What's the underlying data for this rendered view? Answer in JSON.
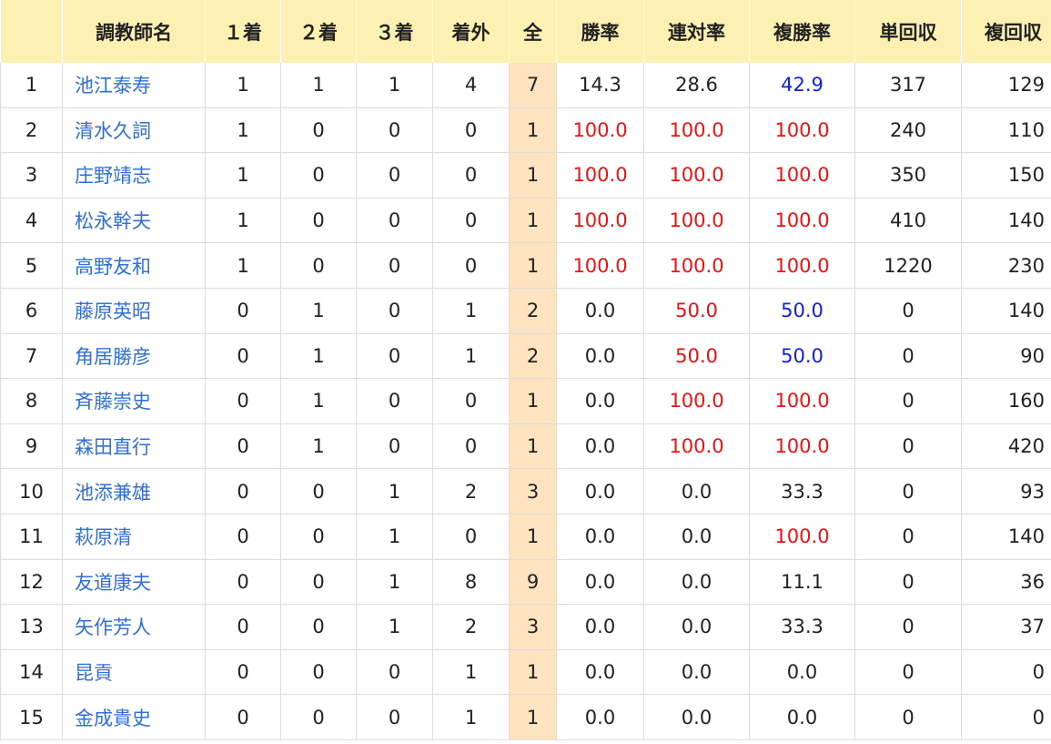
{
  "header": {
    "rank": "",
    "trainer": "調教師名",
    "first": "１着",
    "second": "２着",
    "third": "３着",
    "out": "着外",
    "total": "全",
    "win_rate": "勝率",
    "quinella_rate": "連対率",
    "place_rate": "複勝率",
    "win_return": "単回収",
    "place_return": "複回収"
  },
  "rows": [
    {
      "rank": "1",
      "name": "池江泰寿",
      "c1": "1",
      "c2": "1",
      "c3": "1",
      "out": "4",
      "total": "7",
      "win": "14.3",
      "quin": "28.6",
      "place": "42.9",
      "wret": "317",
      "pret": "129"
    },
    {
      "rank": "2",
      "name": "清水久詞",
      "c1": "1",
      "c2": "0",
      "c3": "0",
      "out": "0",
      "total": "1",
      "win": "100.0",
      "quin": "100.0",
      "place": "100.0",
      "wret": "240",
      "pret": "110"
    },
    {
      "rank": "3",
      "name": "庄野靖志",
      "c1": "1",
      "c2": "0",
      "c3": "0",
      "out": "0",
      "total": "1",
      "win": "100.0",
      "quin": "100.0",
      "place": "100.0",
      "wret": "350",
      "pret": "150"
    },
    {
      "rank": "4",
      "name": "松永幹夫",
      "c1": "1",
      "c2": "0",
      "c3": "0",
      "out": "0",
      "total": "1",
      "win": "100.0",
      "quin": "100.0",
      "place": "100.0",
      "wret": "410",
      "pret": "140"
    },
    {
      "rank": "5",
      "name": "高野友和",
      "c1": "1",
      "c2": "0",
      "c3": "0",
      "out": "0",
      "total": "1",
      "win": "100.0",
      "quin": "100.0",
      "place": "100.0",
      "wret": "1220",
      "pret": "230"
    },
    {
      "rank": "6",
      "name": "藤原英昭",
      "c1": "0",
      "c2": "1",
      "c3": "0",
      "out": "1",
      "total": "2",
      "win": "0.0",
      "quin": "50.0",
      "place": "50.0",
      "wret": "0",
      "pret": "140"
    },
    {
      "rank": "7",
      "name": "角居勝彦",
      "c1": "0",
      "c2": "1",
      "c3": "0",
      "out": "1",
      "total": "2",
      "win": "0.0",
      "quin": "50.0",
      "place": "50.0",
      "wret": "0",
      "pret": "90"
    },
    {
      "rank": "8",
      "name": "斉藤崇史",
      "c1": "0",
      "c2": "1",
      "c3": "0",
      "out": "0",
      "total": "1",
      "win": "0.0",
      "quin": "100.0",
      "place": "100.0",
      "wret": "0",
      "pret": "160"
    },
    {
      "rank": "9",
      "name": "森田直行",
      "c1": "0",
      "c2": "1",
      "c3": "0",
      "out": "0",
      "total": "1",
      "win": "0.0",
      "quin": "100.0",
      "place": "100.0",
      "wret": "0",
      "pret": "420"
    },
    {
      "rank": "10",
      "name": "池添兼雄",
      "c1": "0",
      "c2": "0",
      "c3": "1",
      "out": "2",
      "total": "3",
      "win": "0.0",
      "quin": "0.0",
      "place": "33.3",
      "wret": "0",
      "pret": "93"
    },
    {
      "rank": "11",
      "name": "萩原清",
      "c1": "0",
      "c2": "0",
      "c3": "1",
      "out": "0",
      "total": "1",
      "win": "0.0",
      "quin": "0.0",
      "place": "100.0",
      "wret": "0",
      "pret": "140"
    },
    {
      "rank": "12",
      "name": "友道康夫",
      "c1": "0",
      "c2": "0",
      "c3": "1",
      "out": "8",
      "total": "9",
      "win": "0.0",
      "quin": "0.0",
      "place": "11.1",
      "wret": "0",
      "pret": "36"
    },
    {
      "rank": "13",
      "name": "矢作芳人",
      "c1": "0",
      "c2": "0",
      "c3": "1",
      "out": "2",
      "total": "3",
      "win": "0.0",
      "quin": "0.0",
      "place": "33.3",
      "wret": "0",
      "pret": "37"
    },
    {
      "rank": "14",
      "name": "昆貢",
      "c1": "0",
      "c2": "0",
      "c3": "0",
      "out": "1",
      "total": "1",
      "win": "0.0",
      "quin": "0.0",
      "place": "0.0",
      "wret": "0",
      "pret": "0"
    },
    {
      "rank": "15",
      "name": "金成貴史",
      "c1": "0",
      "c2": "0",
      "c3": "0",
      "out": "1",
      "total": "1",
      "win": "0.0",
      "quin": "0.0",
      "place": "0.0",
      "wret": "0",
      "pret": "0"
    }
  ],
  "colors": {
    "header_bg": "#fdf0b3",
    "total_bg": "#fde3c0",
    "link": "#2f6fd6",
    "high_rate": "#ee1111",
    "mid_rate": "#1020e8"
  }
}
